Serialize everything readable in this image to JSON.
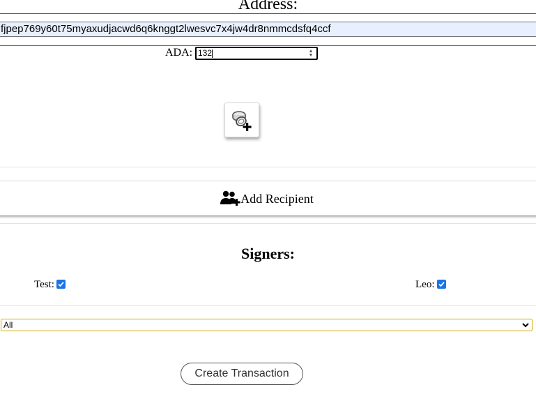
{
  "address": {
    "title": "Address:",
    "value": "fjpep769y60t75myaxudjacwd6q6knggt2lwesvc7x4jw4dr8nmmcdsfq4ccf"
  },
  "ada": {
    "label": "ADA:",
    "value": "132"
  },
  "add_token": {
    "icon": "coins-plus-icon"
  },
  "recipient": {
    "label": "Add Recipient",
    "icon": "users-plus-icon"
  },
  "signers": {
    "title": "Signers:",
    "items": [
      {
        "label": "Test:",
        "checked": true
      },
      {
        "label": "Leo:",
        "checked": true
      }
    ]
  },
  "filter": {
    "selected": "All"
  },
  "actions": {
    "create_label": "Create Transaction"
  },
  "colors": {
    "accent_line": "#2f7d2f",
    "checkbox": "#1a73e8",
    "select_border": "#d4a800",
    "input_autofill": "#e8f0fe"
  }
}
